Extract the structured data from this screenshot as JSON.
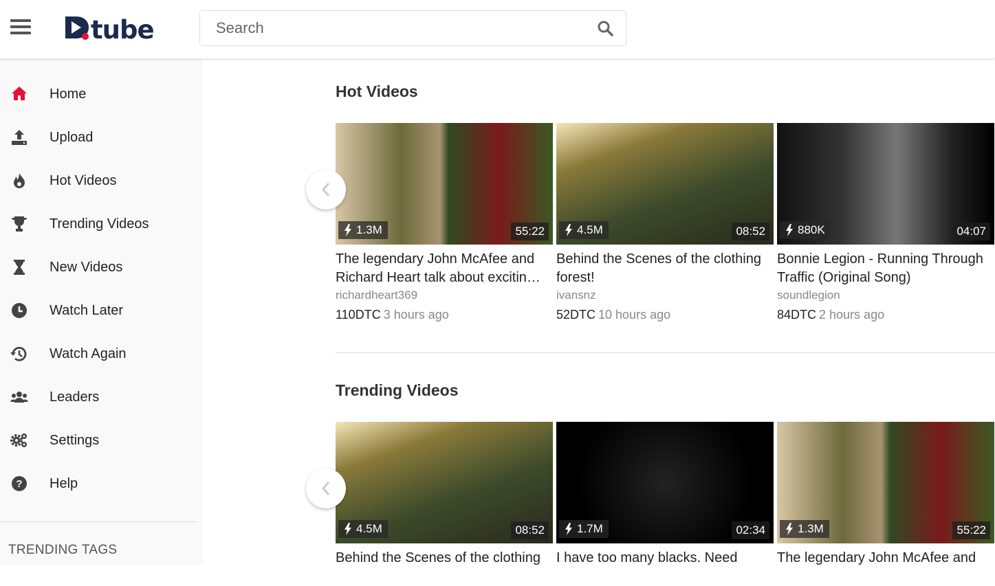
{
  "header": {
    "logo": "D.tube",
    "search_placeholder": "Search"
  },
  "sidebar": {
    "items": [
      {
        "label": "Home",
        "icon": "home-icon"
      },
      {
        "label": "Upload",
        "icon": "upload-icon"
      },
      {
        "label": "Hot Videos",
        "icon": "fire-icon"
      },
      {
        "label": "Trending Videos",
        "icon": "trophy-icon"
      },
      {
        "label": "New Videos",
        "icon": "hourglass-icon"
      },
      {
        "label": "Watch Later",
        "icon": "clock-icon"
      },
      {
        "label": "Watch Again",
        "icon": "history-icon"
      },
      {
        "label": "Leaders",
        "icon": "users-icon"
      },
      {
        "label": "Settings",
        "icon": "gear-icon"
      },
      {
        "label": "Help",
        "icon": "help-icon"
      }
    ],
    "trending_tags": "TRENDING TAGS",
    "active_color": "#e31337"
  },
  "sections": [
    {
      "title": "Hot Videos",
      "videos": [
        {
          "title": "The legendary John McAfee and Richard Heart talk about excitin…",
          "channel": "richardheart369",
          "views": "1.3M",
          "duration": "55:22",
          "dtc": "110DTC",
          "ago": "3 hours ago"
        },
        {
          "title": "Behind the Scenes of the clothing forest!",
          "channel": "ivansnz",
          "views": "4.5M",
          "duration": "08:52",
          "dtc": "52DTC",
          "ago": "10 hours ago"
        },
        {
          "title": "Bonnie Legion - Running Through Traffic (Original Song)",
          "channel": "soundlegion",
          "views": "880K",
          "duration": "04:07",
          "dtc": "84DTC",
          "ago": "2 hours ago"
        }
      ]
    },
    {
      "title": "Trending Videos",
      "videos": [
        {
          "title": "Behind the Scenes of the clothing",
          "views": "4.5M",
          "duration": "08:52"
        },
        {
          "title": "I have too many blacks. Need",
          "views": "1.7M",
          "duration": "02:34"
        },
        {
          "title": "The legendary John McAfee and",
          "views": "1.3M",
          "duration": "55:22"
        }
      ]
    }
  ]
}
